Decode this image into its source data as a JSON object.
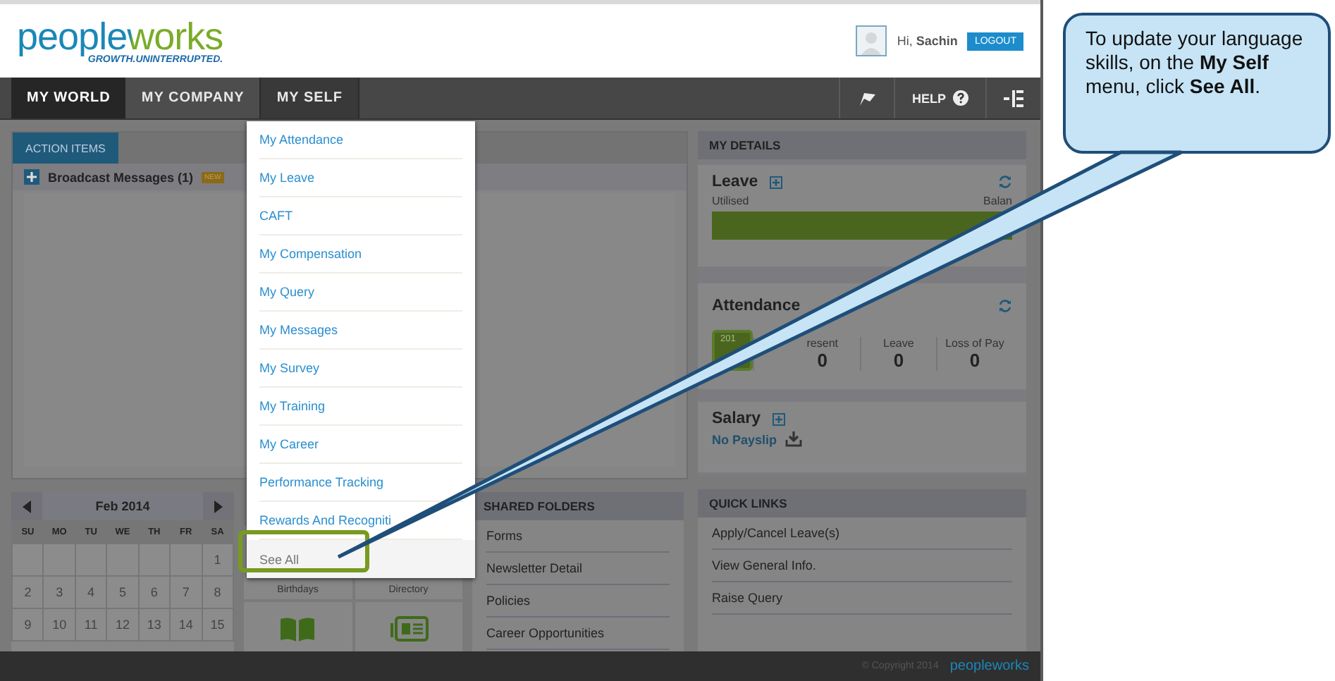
{
  "header": {
    "logo": "peopleworks",
    "tagline": "GROWTH.UNINTERRUPTED.",
    "greeting": "Hi,",
    "user": "Sachin",
    "logout": "LOGOUT"
  },
  "nav": {
    "tabs": [
      {
        "label": "MY WORLD",
        "selected": true,
        "open": false
      },
      {
        "label": "MY COMPANY",
        "selected": false,
        "open": false
      },
      {
        "label": "MY SELF",
        "selected": false,
        "open": true
      }
    ],
    "help": "HELP"
  },
  "menu": {
    "items": [
      {
        "label": "My Attendance",
        "highlighted": false
      },
      {
        "label": "My Leave",
        "highlighted": false
      },
      {
        "label": "CAFT",
        "highlighted": false
      },
      {
        "label": "My Compensation",
        "highlighted": false
      },
      {
        "label": "My Query",
        "highlighted": false
      },
      {
        "label": "My Messages",
        "highlighted": false
      },
      {
        "label": "My Survey",
        "highlighted": false
      },
      {
        "label": "My Training",
        "highlighted": false
      },
      {
        "label": "My Career",
        "highlighted": false
      },
      {
        "label": "Performance Tracking",
        "highlighted": false
      },
      {
        "label": "Rewards And Recogniti",
        "highlighted": false
      },
      {
        "label": "See All",
        "highlighted": true
      }
    ]
  },
  "action_items": {
    "tab": "ACTION ITEMS",
    "broadcast": "Broadcast Messages (1)",
    "badge": "NEW"
  },
  "calendar": {
    "month": "Feb 2014",
    "weekdays": [
      "SU",
      "MO",
      "TU",
      "WE",
      "TH",
      "FR",
      "SA"
    ],
    "days": [
      {
        "kind": "blank"
      },
      {
        "kind": "blank"
      },
      {
        "kind": "blank"
      },
      {
        "kind": "blank"
      },
      {
        "kind": "blank"
      },
      {
        "kind": "blank"
      },
      {
        "kind": "day",
        "label": "1"
      },
      {
        "kind": "day",
        "label": "2"
      },
      {
        "kind": "day",
        "label": "3"
      },
      {
        "kind": "day",
        "label": "4"
      },
      {
        "kind": "day",
        "label": "5"
      },
      {
        "kind": "day",
        "label": "6"
      },
      {
        "kind": "day",
        "label": "7"
      },
      {
        "kind": "day",
        "label": "8"
      },
      {
        "kind": "day",
        "label": "9"
      },
      {
        "kind": "day",
        "label": "10"
      },
      {
        "kind": "day",
        "label": "11"
      },
      {
        "kind": "day",
        "label": "12"
      },
      {
        "kind": "day",
        "label": "13"
      },
      {
        "kind": "day",
        "label": "14"
      },
      {
        "kind": "day",
        "label": "15"
      }
    ]
  },
  "tiles": [
    {
      "kind": "label",
      "label": "Birthdays"
    },
    {
      "kind": "label",
      "label": "Directory"
    },
    {
      "kind": "book"
    },
    {
      "kind": "card"
    }
  ],
  "shared_folders": {
    "title": "SHARED FOLDERS",
    "items": [
      "Forms",
      "Newsletter Detail",
      "Policies",
      "Career Opportunities"
    ]
  },
  "my_details": {
    "title": "MY DETAILS",
    "leave": {
      "title": "Leave",
      "utilised": "Utilised",
      "balance": "Balan",
      "level": 1
    },
    "attendance": {
      "title": "Attendance",
      "year": "201",
      "stats": [
        {
          "label": "resent",
          "value": "0"
        },
        {
          "label": "Leave",
          "value": "0"
        },
        {
          "label": "Loss of Pay",
          "value": "0"
        }
      ]
    },
    "salary": {
      "title": "Salary",
      "link": "No Payslip"
    }
  },
  "quick_links": {
    "title": "QUICK LINKS",
    "items": [
      "Apply/Cancel Leave(s)",
      "View General Info.",
      "Raise Query"
    ]
  },
  "footer": {
    "copyright": "© Copyright 2014",
    "logo": "peopleworks"
  },
  "callout": {
    "text": "To update your language skills, on the **My Self** menu, click **See All**."
  }
}
